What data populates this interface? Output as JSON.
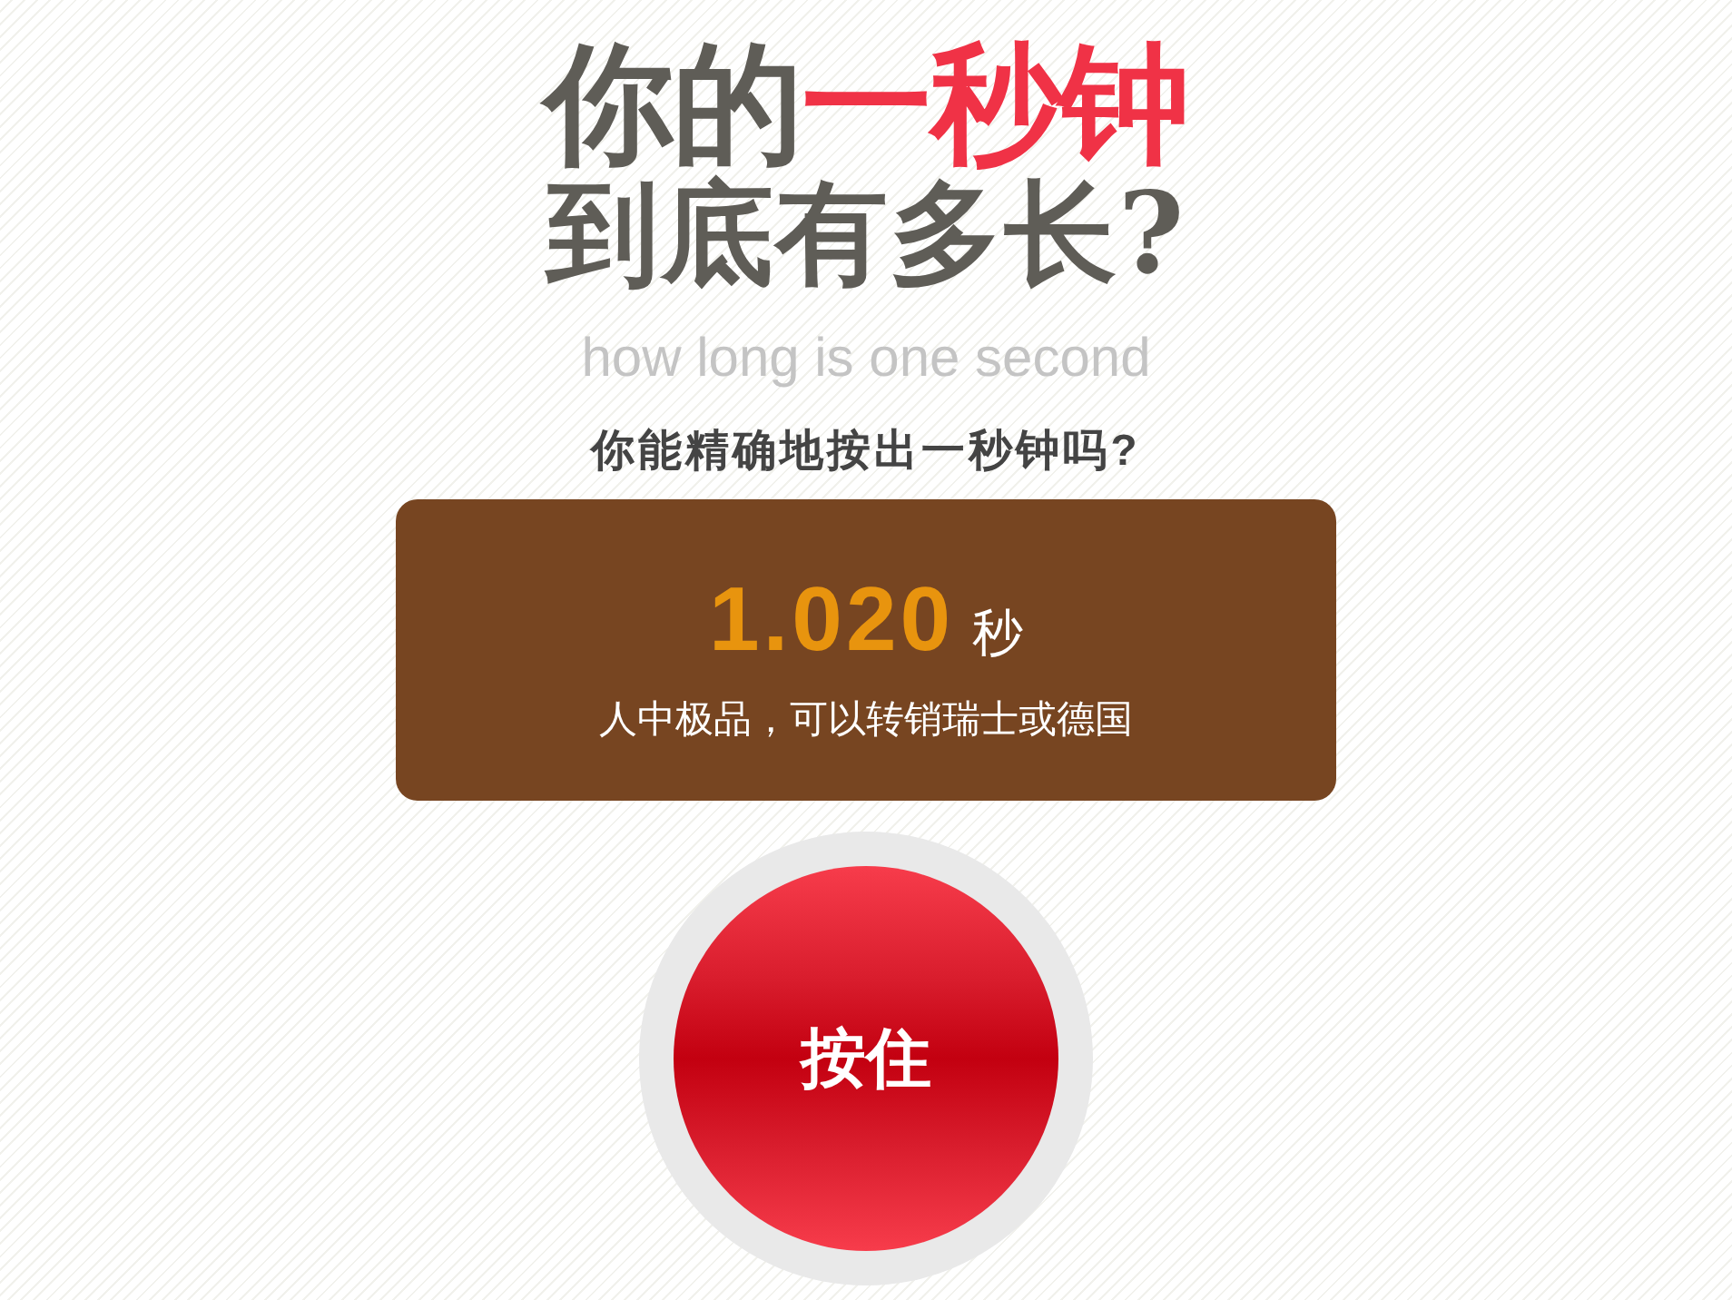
{
  "title": {
    "lines": [
      [
        {
          "text": "你的",
          "highlight": false
        },
        {
          "text": "一秒钟",
          "highlight": true
        }
      ],
      [
        {
          "text": "到底有多长?",
          "highlight": false
        }
      ]
    ]
  },
  "subtitle": "how long is one second",
  "question": "你能精确地按出一秒钟吗?",
  "result": {
    "time": "1.020",
    "unit": "秒",
    "comment": "人中极品，可以转销瑞士或德国"
  },
  "hold_button": {
    "label": "按住"
  }
}
